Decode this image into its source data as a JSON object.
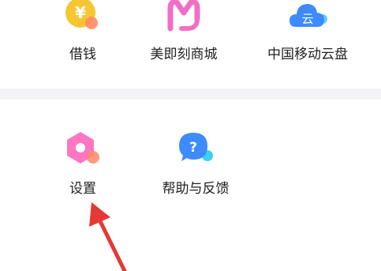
{
  "grid": {
    "row1": [
      {
        "label": "借钱",
        "icon": "yuan-coin-icon",
        "color": "#F7C531"
      },
      {
        "label": "美即刻商城",
        "icon": "m-mall-icon",
        "color": "#F06FC6"
      },
      {
        "label": "中国移动云盘",
        "icon": "cloud-icon",
        "color": "#3D8BFF"
      }
    ],
    "row2": [
      {
        "label": "设置",
        "icon": "hexagon-settings-icon",
        "color": "#FF77C0"
      },
      {
        "label": "帮助与反馈",
        "icon": "help-bubble-icon",
        "color": "#3D8BFF"
      }
    ]
  },
  "icons": {
    "borrow_glyph": "¥",
    "help_glyph": "?",
    "cloud_glyph": "云"
  },
  "colors": {
    "accent_orange": "#FF8A65",
    "arrow_red": "#E53935",
    "divider": "#F3F3F5"
  }
}
